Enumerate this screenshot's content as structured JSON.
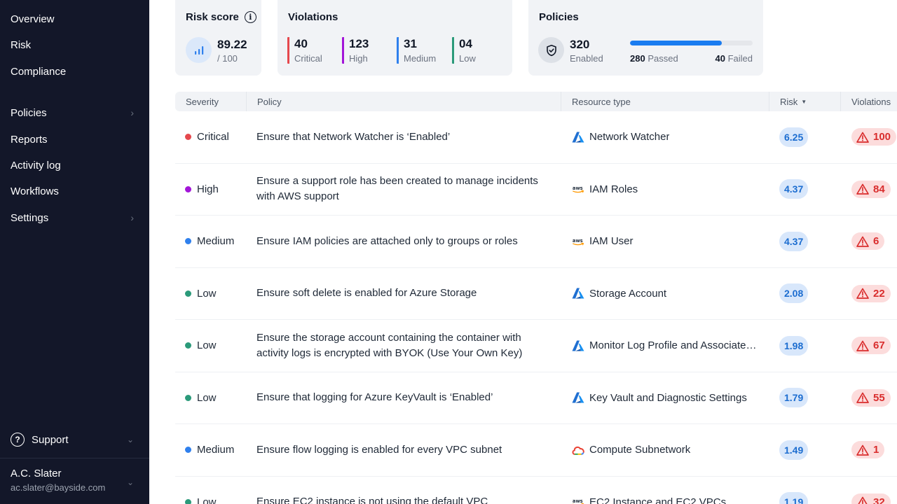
{
  "sidebar": {
    "nav": [
      {
        "label": "Overview",
        "chevron": false
      },
      {
        "label": "Risk",
        "chevron": false
      },
      {
        "label": "Compliance",
        "chevron": false
      },
      {
        "label": "Policies",
        "chevron": true
      },
      {
        "label": "Reports",
        "chevron": false
      },
      {
        "label": "Activity log",
        "chevron": false
      },
      {
        "label": "Workflows",
        "chevron": false
      },
      {
        "label": "Settings",
        "chevron": true
      }
    ],
    "support_label": "Support",
    "user": {
      "name": "A.C. Slater",
      "email": "ac.slater@bayside.com"
    }
  },
  "cards": {
    "risk": {
      "title": "Risk score",
      "value": "89.22",
      "denominator": "/ 100"
    },
    "violations": {
      "title": "Violations",
      "items": [
        {
          "count": "40",
          "label": "Critical",
          "color": "#e5484d"
        },
        {
          "count": "123",
          "label": "High",
          "color": "#a215d8"
        },
        {
          "count": "31",
          "label": "Medium",
          "color": "#2f80ed"
        },
        {
          "count": "04",
          "label": "Low",
          "color": "#2b9a7a"
        }
      ]
    },
    "policies": {
      "title": "Policies",
      "enabled_count": "320",
      "enabled_label": "Enabled",
      "passed_count": "280",
      "passed_label": "Passed",
      "failed_count": "40",
      "failed_label": "Failed",
      "passed_fraction": 0.75
    }
  },
  "table": {
    "columns": {
      "severity": "Severity",
      "policy": "Policy",
      "resource": "Resource type",
      "risk": "Risk",
      "violations": "Violations"
    },
    "rows": [
      {
        "severity": "Critical",
        "sev_color": "#e5484d",
        "policy": "Ensure that Network Watcher is ‘Enabled’",
        "provider": "azure",
        "resource": "Network Watcher",
        "risk": "6.25",
        "violations": "100"
      },
      {
        "severity": "High",
        "sev_color": "#a215d8",
        "policy": "Ensure a support role has been created to manage incidents with AWS support",
        "provider": "aws",
        "resource": "IAM Roles",
        "risk": "4.37",
        "violations": "84"
      },
      {
        "severity": "Medium",
        "sev_color": "#2f80ed",
        "policy": "Ensure IAM policies are attached only to groups or roles",
        "provider": "aws",
        "resource": "IAM User",
        "risk": "4.37",
        "violations": "6"
      },
      {
        "severity": "Low",
        "sev_color": "#2b9a7a",
        "policy": "Ensure soft delete is enabled for Azure Storage",
        "provider": "azure",
        "resource": "Storage Account",
        "risk": "2.08",
        "violations": "22"
      },
      {
        "severity": "Low",
        "sev_color": "#2b9a7a",
        "policy": "Ensure the storage account containing the container with activity logs is encrypted with BYOK (Use Your Own Key)",
        "provider": "azure",
        "resource": "Monitor Log Profile and Associated Storage Account",
        "risk": "1.98",
        "violations": "67"
      },
      {
        "severity": "Low",
        "sev_color": "#2b9a7a",
        "policy": "Ensure that logging for Azure KeyVault is ‘Enabled’",
        "provider": "azure",
        "resource": "Key Vault and Diagnostic Settings",
        "risk": "1.79",
        "violations": "55"
      },
      {
        "severity": "Medium",
        "sev_color": "#2f80ed",
        "policy": "Ensure flow logging is enabled for every VPC subnet",
        "provider": "gcp",
        "resource": "Compute Subnetwork",
        "risk": "1.49",
        "violations": "1"
      },
      {
        "severity": "Low",
        "sev_color": "#2b9a7a",
        "policy": "Ensure EC2 instance is not using the default VPC",
        "provider": "aws",
        "resource": "EC2 Instance and EC2 VPCs",
        "risk": "1.19",
        "violations": "32"
      }
    ]
  }
}
